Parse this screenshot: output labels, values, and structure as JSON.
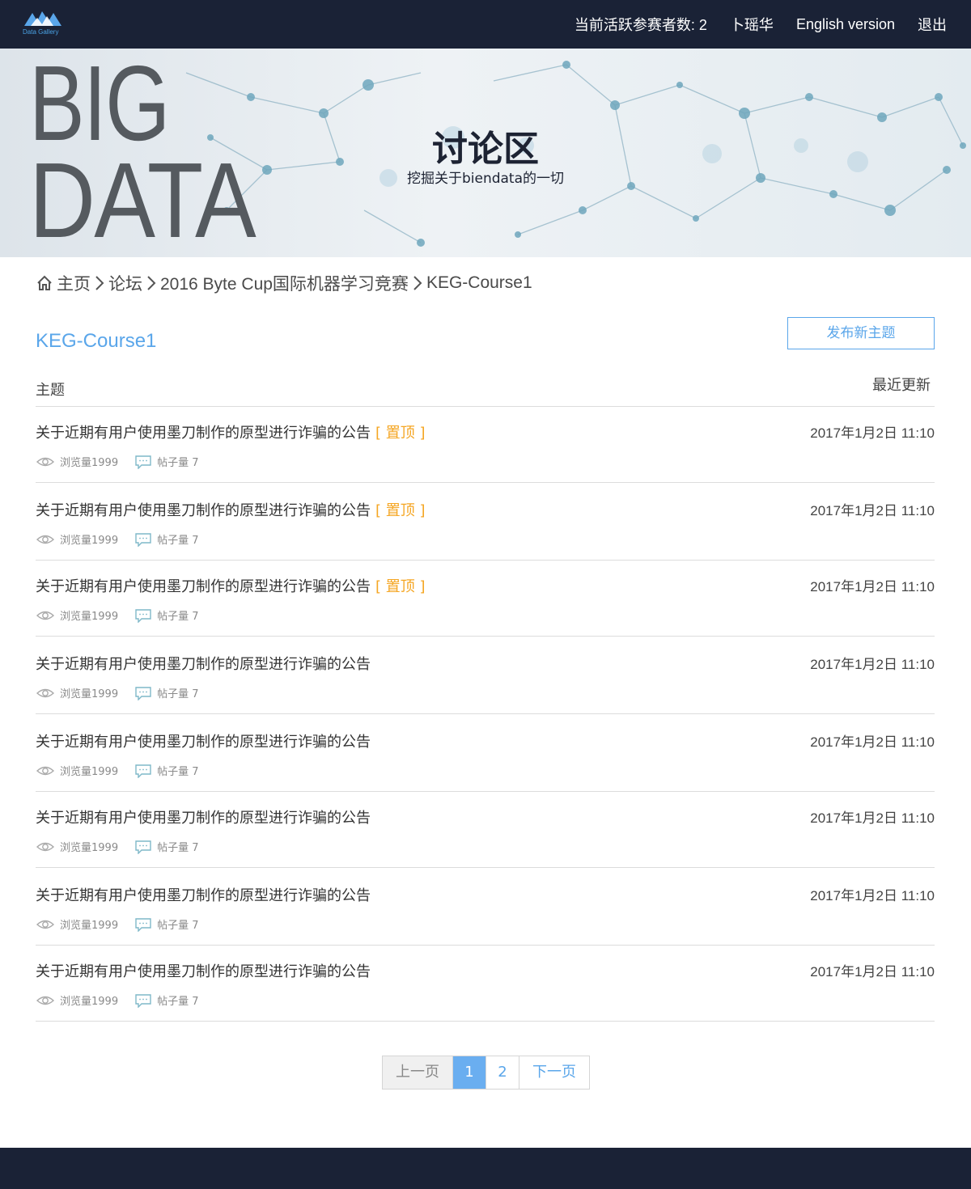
{
  "header": {
    "logo_text": "Data Gallery",
    "active_participants": "当前活跃参赛者数: 2",
    "username": "卜瑶华",
    "language": "English version",
    "logout": "退出"
  },
  "banner": {
    "big_line1": "BIG",
    "big_line2": "DATA",
    "title": "讨论区",
    "subtitle": "挖掘关于biendata的一切"
  },
  "breadcrumb": {
    "home": "主页",
    "forum": "论坛",
    "competition": "2016 Byte Cup国际机器学习竞赛",
    "current": "KEG-Course1"
  },
  "section": {
    "title": "KEG-Course1",
    "new_topic_button": "发布新主题",
    "col_topic": "主题",
    "col_updated": "最近更新"
  },
  "topics": [
    {
      "title": "关于近期有用户使用墨刀制作的原型进行诈骗的公告",
      "pinned": "[ 置顶 ]",
      "views": "浏览量1999",
      "posts": "帖子量 7",
      "date": "2017年1月2日 11:10"
    },
    {
      "title": "关于近期有用户使用墨刀制作的原型进行诈骗的公告",
      "pinned": "[ 置顶 ]",
      "views": "浏览量1999",
      "posts": "帖子量 7",
      "date": "2017年1月2日 11:10"
    },
    {
      "title": "关于近期有用户使用墨刀制作的原型进行诈骗的公告",
      "pinned": "[ 置顶 ]",
      "views": "浏览量1999",
      "posts": "帖子量 7",
      "date": "2017年1月2日 11:10"
    },
    {
      "title": "关于近期有用户使用墨刀制作的原型进行诈骗的公告",
      "pinned": "",
      "views": "浏览量1999",
      "posts": "帖子量 7",
      "date": "2017年1月2日 11:10"
    },
    {
      "title": "关于近期有用户使用墨刀制作的原型进行诈骗的公告",
      "pinned": "",
      "views": "浏览量1999",
      "posts": "帖子量 7",
      "date": "2017年1月2日 11:10"
    },
    {
      "title": "关于近期有用户使用墨刀制作的原型进行诈骗的公告",
      "pinned": "",
      "views": "浏览量1999",
      "posts": "帖子量 7",
      "date": "2017年1月2日 11:10"
    },
    {
      "title": "关于近期有用户使用墨刀制作的原型进行诈骗的公告",
      "pinned": "",
      "views": "浏览量1999",
      "posts": "帖子量 7",
      "date": "2017年1月2日 11:10"
    },
    {
      "title": "关于近期有用户使用墨刀制作的原型进行诈骗的公告",
      "pinned": "",
      "views": "浏览量1999",
      "posts": "帖子量 7",
      "date": "2017年1月2日 11:10"
    }
  ],
  "pagination": {
    "prev": "上一页",
    "page1": "1",
    "page2": "2",
    "next": "下一页"
  },
  "colors": {
    "nav_bg": "#1a2236",
    "accent": "#5aa6ea",
    "pinned": "#f5a623"
  }
}
